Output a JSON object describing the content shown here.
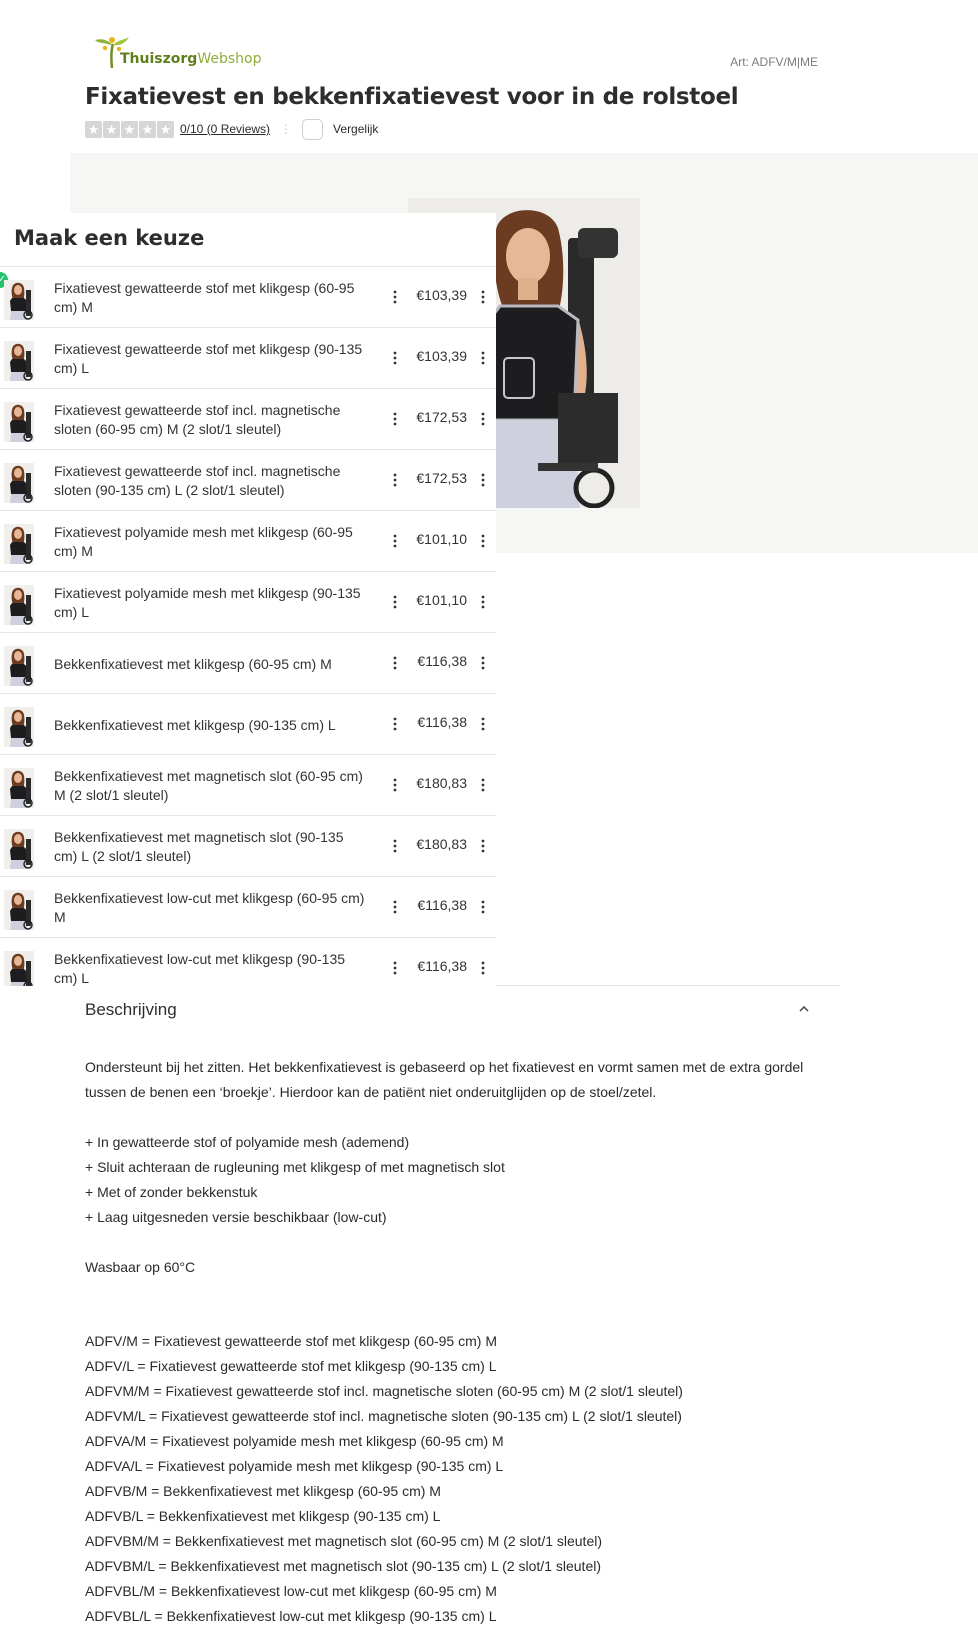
{
  "header": {
    "logo_text_a": "Thuiszorg",
    "logo_text_b": "Webshop",
    "art_number": "Art: ADFV/M|ME",
    "title": "Fixatievest en bekkenfixatievest voor in de rolstoel",
    "rating_text": "0/10 (0 Reviews)",
    "compare_label": "Vergelijk"
  },
  "panel": {
    "title": "Maak een keuze",
    "options": [
      {
        "name": "Fixatievest gewatteerde stof met klikgesp (60-95 cm) M",
        "price": "€103,39",
        "selected": true
      },
      {
        "name": "Fixatievest gewatteerde stof met klikgesp (90-135 cm) L",
        "price": "€103,39"
      },
      {
        "name": "Fixatievest gewatteerde stof incl. magnetische sloten (60-95 cm) M (2 slot/1 sleutel)",
        "price": "€172,53"
      },
      {
        "name": "Fixatievest gewatteerde stof incl. magnetische sloten (90-135 cm) L (2 slot/1 sleutel)",
        "price": "€172,53"
      },
      {
        "name": "Fixatievest polyamide mesh met klikgesp (60-95 cm) M",
        "price": "€101,10"
      },
      {
        "name": "Fixatievest polyamide mesh met klikgesp (90-135 cm) L",
        "price": "€101,10"
      },
      {
        "name": "Bekkenfixatievest met klikgesp (60-95 cm) M",
        "price": "€116,38"
      },
      {
        "name": "Bekkenfixatievest met klikgesp (90-135 cm) L",
        "price": "€116,38"
      },
      {
        "name": "Bekkenfixatievest met magnetisch slot (60-95 cm) M (2 slot/1 sleutel)",
        "price": "€180,83"
      },
      {
        "name": "Bekkenfixatievest met magnetisch slot (90-135 cm) L (2 slot/1 sleutel)",
        "price": "€180,83"
      },
      {
        "name": "Bekkenfixatievest low-cut met klikgesp (60-95 cm) M",
        "price": "€116,38"
      },
      {
        "name": "Bekkenfixatievest low-cut met klikgesp (90-135 cm) L",
        "price": "€116,38"
      }
    ]
  },
  "description": {
    "title": "Beschrijving",
    "intro": "Ondersteunt bij het zitten. Het bekkenfixatievest is gebaseerd op het fixatievest en vormt samen met de extra gordel tussen de benen een ‘broekje’. Hierdoor kan de patiënt niet onderuitglijden op de stoel/zetel.",
    "features": [
      "+ In gewatteerde stof of polyamide mesh (ademend)",
      "+ Sluit achteraan de rugleuning met klikgesp of met magnetisch slot",
      "+ Met of zonder bekkenstuk",
      "+ Laag uitgesneden versie beschikbaar (low-cut)"
    ],
    "wash": "Wasbaar op 60°C",
    "codes": [
      "ADFV/M = Fixatievest gewatteerde stof met klikgesp (60-95 cm) M",
      "ADFV/L = Fixatievest gewatteerde stof met klikgesp (90-135 cm) L",
      "ADFVM/M = Fixatievest gewatteerde stof incl. magnetische sloten (60-95 cm) M (2 slot/1 sleutel)",
      "ADFVM/L = Fixatievest gewatteerde stof incl. magnetische sloten (90-135 cm) L (2 slot/1 sleutel)",
      "ADFVA/M = Fixatievest polyamide mesh met klikgesp (60-95 cm) M",
      "ADFVA/L = Fixatievest polyamide mesh met klikgesp (90-135 cm) L",
      "ADFVB/M = Bekkenfixatievest met klikgesp (60-95 cm) M",
      "ADFVB/L = Bekkenfixatievest met klikgesp (90-135 cm) L",
      "ADFVBM/M = Bekkenfixatievest met magnetisch slot (60-95 cm) M (2 slot/1 sleutel)",
      "ADFVBM/L = Bekkenfixatievest met magnetisch slot (90-135 cm) L (2 slot/1 sleutel)",
      "ADFVBL/M = Bekkenfixatievest low-cut met klikgesp (60-95 cm) M",
      "ADFVBL/L = Bekkenfixatievest low-cut met klikgesp (90-135 cm) L"
    ]
  },
  "colors": {
    "accent_check": "#23c16b",
    "star_empty": "#d6d6d6",
    "logo_green": "#5f7f1b",
    "gallery_bg": "#f6f6f5"
  },
  "icons": [
    "logo-icon",
    "star-icon",
    "checkbox-icon",
    "check-icon",
    "more-vertical-icon",
    "chevron-up-icon"
  ]
}
